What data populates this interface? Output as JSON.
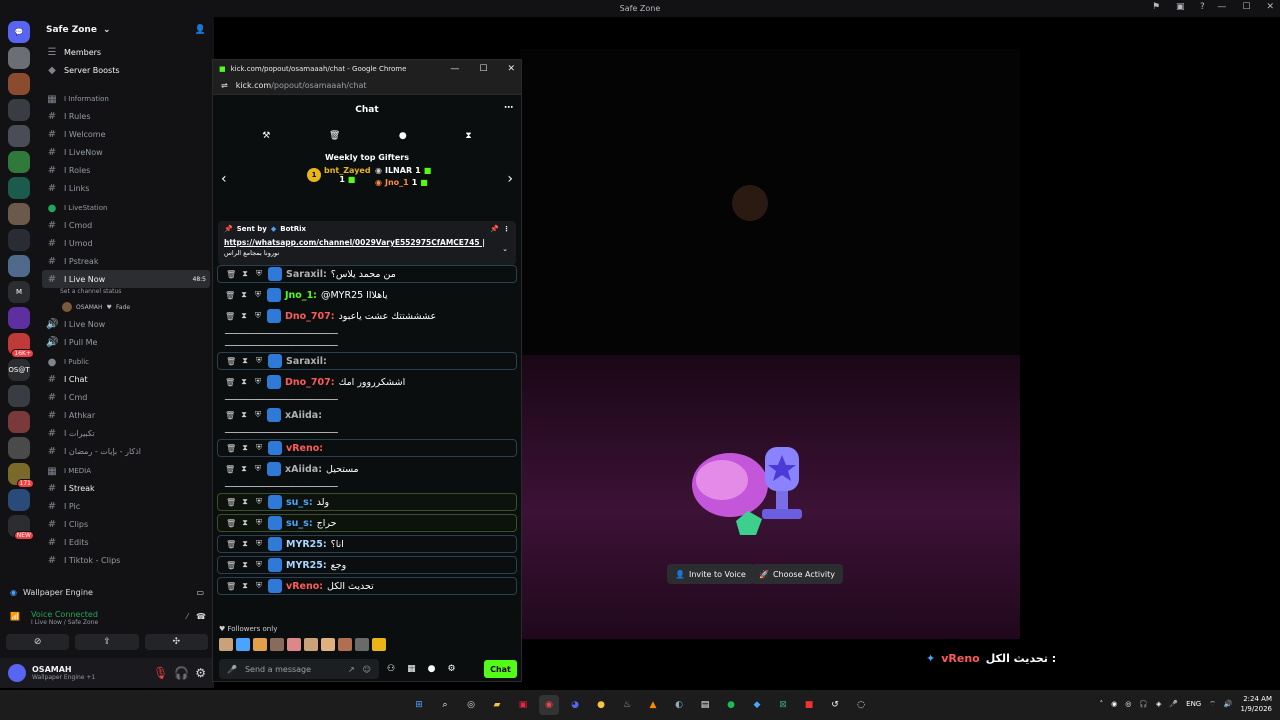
{
  "window_title": "Safe Zone",
  "server_name": "Safe Zone",
  "servers": [
    {
      "label": "💬",
      "color": "#5865f2"
    },
    {
      "label": "",
      "color": "#6b6e75"
    },
    {
      "label": "",
      "color": "#8a4b2f"
    },
    {
      "label": "",
      "color": "#3a3c43"
    },
    {
      "label": "",
      "color": "#4a4d55"
    },
    {
      "label": "",
      "color": "#2f7a3a"
    },
    {
      "label": "",
      "color": "#1d5a4e"
    },
    {
      "label": "",
      "color": "#6b5a4a"
    },
    {
      "label": "",
      "color": "#2a2c33"
    },
    {
      "label": "",
      "color": "#4f6a8a"
    },
    {
      "label": "M",
      "color": "#2b2d31"
    },
    {
      "label": "",
      "color": "#5d2fa0"
    },
    {
      "label": "",
      "color": "#c03a3a"
    },
    {
      "label": "OS@T",
      "color": "#2b2d31"
    },
    {
      "label": "",
      "color": "#3a3c43"
    },
    {
      "label": "",
      "color": "#7a3a3a"
    },
    {
      "label": "",
      "color": "#4a4a4a"
    },
    {
      "label": "",
      "color": "#7a6a2a"
    },
    {
      "label": "",
      "color": "#2a4a7a"
    },
    {
      "label": "",
      "color": "#2b2d31"
    }
  ],
  "server_badges": [
    "16K+",
    "171",
    "NEW"
  ],
  "channels": {
    "members": "Members",
    "server_boosts": "Server Boosts",
    "cat_information": "I Information",
    "rules": "I Rules",
    "welcome": "I Welcome",
    "livenow": "I LiveNow",
    "roles": "I Roles",
    "links": "I Links",
    "cat_livestation": "I LiveStation",
    "cmod": "I Cmod",
    "umod": "I Umod",
    "pstreak": "I Pstreak",
    "live_now": "I Live Now",
    "live_now_sub": "Set a channel status",
    "live_now_count": "48:5",
    "voice_user": "OSAMAH",
    "voice_user_tag": "Fade",
    "live_now_2": "I Live Now",
    "pull_me": "I Pull Me",
    "cat_public": "I Public",
    "chat": "I Chat",
    "cmd": "I Cmd",
    "athkar": "I Athkar",
    "takbirat": "I تكبيرات",
    "athkar2": "I اذكار - بإيات - رمضان",
    "cat_media": "I MEDIA",
    "streak": "I Streak",
    "pic": "I Pic",
    "clips": "I Clips",
    "edits": "I Edits",
    "tiktok": "I Tiktok - Clips"
  },
  "bottom": {
    "wallpaper_engine": "Wallpaper Engine",
    "voice_connected": "Voice Connected",
    "voice_path": "I Live Now / Safe Zone",
    "username": "OSAMAH",
    "user_status": "Wallpaper Engine +1"
  },
  "stage": {
    "invite": "Invite to Voice",
    "activity": "Choose Activity"
  },
  "overlay": {
    "user": "vReno",
    "text": "تحديث الكل :"
  },
  "chrome": {
    "title": "kick.com/popout/osamaaah/chat - Google Chrome",
    "url_host": "kick.com",
    "url_path": "/popout/osamaaah/chat"
  },
  "kick": {
    "header": "Chat",
    "gifters_title": "Weekly top Gifters",
    "gifters": [
      {
        "name": "bnt_Zayed",
        "count": "1",
        "color": "#e9b517"
      },
      {
        "name": "ILNAR",
        "count": "1",
        "color": "#ffffff"
      },
      {
        "name": "Jno_1",
        "count": "1",
        "color": "#ff8a3d"
      }
    ],
    "pinned_by": "Sent by",
    "pinned_bot": "BotRix",
    "pinned_link": "https://whatsapp.com/channel/0029VaryE552975CfAMCE745 |",
    "pinned_sub": "نورونا بمجامع الراس",
    "messages": [
      {
        "user": "Saraxil:",
        "color": "#b0b0b0",
        "text": "من محمد يلاس؟",
        "hl": "blue"
      },
      {
        "user": "Jno_1:",
        "color": "#53fc18",
        "text": "@MYR25 ياهلااا",
        "hl": "none"
      },
      {
        "user": "Dno_707:",
        "color": "#ff5a5a",
        "text": "عشششتتك عشت ياعبود",
        "hl": "none"
      },
      {
        "user": "Saraxil:",
        "color": "#b0b0b0",
        "text": "",
        "hl": "blue"
      },
      {
        "user": "Dno_707:",
        "color": "#ff5a5a",
        "text": "اششكرروور امك",
        "hl": "none"
      },
      {
        "user": "xAiida:",
        "color": "#b0b0b0",
        "text": "",
        "hl": "none"
      },
      {
        "user": "vReno:",
        "color": "#ff5a5a",
        "text": "",
        "hl": "blue"
      },
      {
        "user": "xAiida:",
        "color": "#b0b0b0",
        "text": "مستحيل",
        "hl": "none"
      },
      {
        "user": "su_s:",
        "color": "#4aa3ff",
        "text": "ولد",
        "hl": "green"
      },
      {
        "user": "su_s:",
        "color": "#4aa3ff",
        "text": "حراج",
        "hl": "green"
      },
      {
        "user": "MYR25:",
        "color": "#a9d4ff",
        "text": "انا؟",
        "hl": "blue"
      },
      {
        "user": "MYR25:",
        "color": "#a9d4ff",
        "text": "وجع",
        "hl": "blue"
      },
      {
        "user": "vReno:",
        "color": "#ff5a5a",
        "text": "تحديث الكل",
        "hl": "blue"
      }
    ],
    "followers_only": "Followers only",
    "placeholder": "Send a message",
    "chat_button": "Chat"
  },
  "tray": {
    "lang": "ENG",
    "time": "2:24 AM",
    "date": "1/9/2026"
  }
}
